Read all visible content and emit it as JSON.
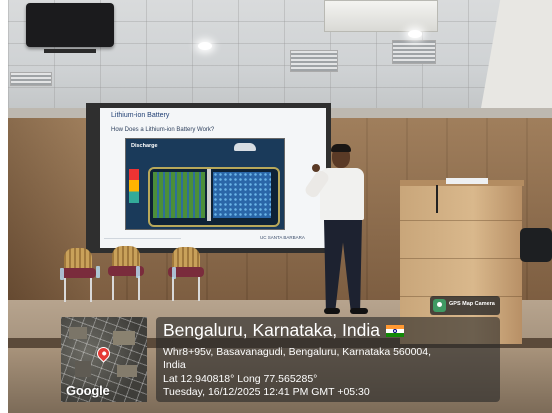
{
  "slide": {
    "title": "Lithium-ion Battery",
    "subtitle": "How Does a Lithium-ion Battery Work?",
    "diagram_label": "Discharge",
    "brand": "UC SANTA BARBARA"
  },
  "gps_badge": {
    "label": "GPS Map Camera"
  },
  "map": {
    "provider_logo": "Google"
  },
  "location": {
    "title": "Bengaluru, Karnataka, India",
    "address_line1": "Whr8+95v, Basavanagudi, Bengaluru, Karnataka 560004,",
    "address_line2": "India",
    "coordinates": "Lat 12.940818° Long 77.565285°",
    "datetime": "Tuesday, 16/12/2025 12:41 PM GMT +05:30",
    "flag_icon": "india-flag-icon"
  }
}
